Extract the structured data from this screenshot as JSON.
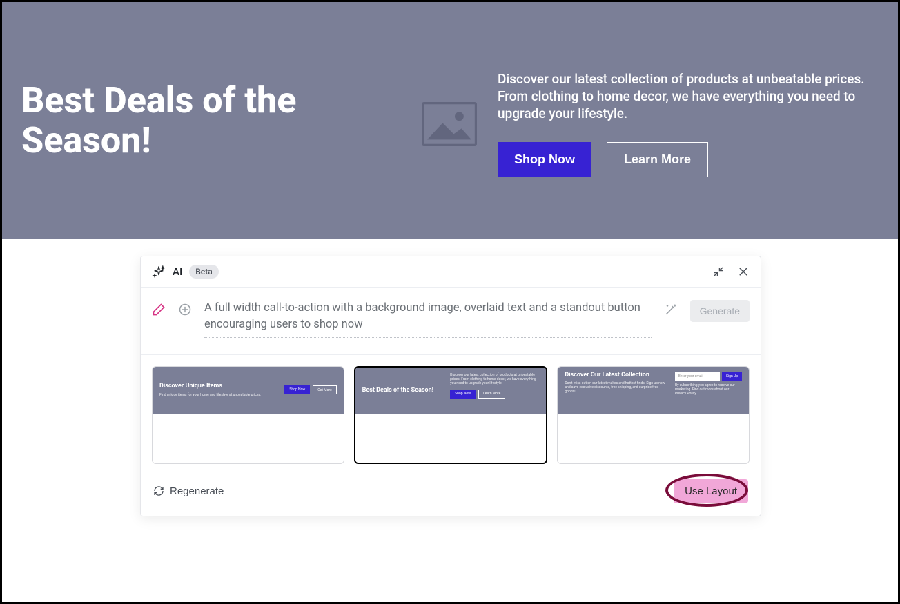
{
  "hero": {
    "title": "Best Deals of the Season!",
    "description": "Discover our latest collection of products at unbeatable prices. From clothing to home decor, we have everything you need to upgrade your lifestyle.",
    "primary_button": "Shop Now",
    "secondary_button": "Learn More"
  },
  "ai_panel": {
    "label": "AI",
    "beta_badge": "Beta",
    "prompt_text": "A full width call-to-action with a background image, overlaid text and a standout button encouraging users to shop now",
    "generate_button": "Generate",
    "regenerate_button": "Regenerate",
    "use_layout_button": "Use Layout",
    "layouts": [
      {
        "title": "Discover Unique Items",
        "subtext": "Find unique items for your home and lifestyle at unbeatable prices.",
        "btn_primary": "Shop Now",
        "btn_secondary": "Get More"
      },
      {
        "title": "Best Deals of the Season!",
        "subtext": "Discover our latest collection of products at unbeatable prices. From clothing to home decor, we have everything you need to upgrade your lifestyle.",
        "btn_primary": "Shop Now",
        "btn_secondary": "Learn More"
      },
      {
        "title": "Discover Our Latest Collection",
        "subtext": "Don't miss out on our latest makes and hottest finds. Sign up now and save exclusive discounts, free shipping, and surprise free goods!",
        "input_placeholder": "Enter your email",
        "btn_primary": "Sign Up",
        "footnote": "By subscribing you agree to receive our marketing. Find out more about our Privacy Policy."
      }
    ]
  }
}
